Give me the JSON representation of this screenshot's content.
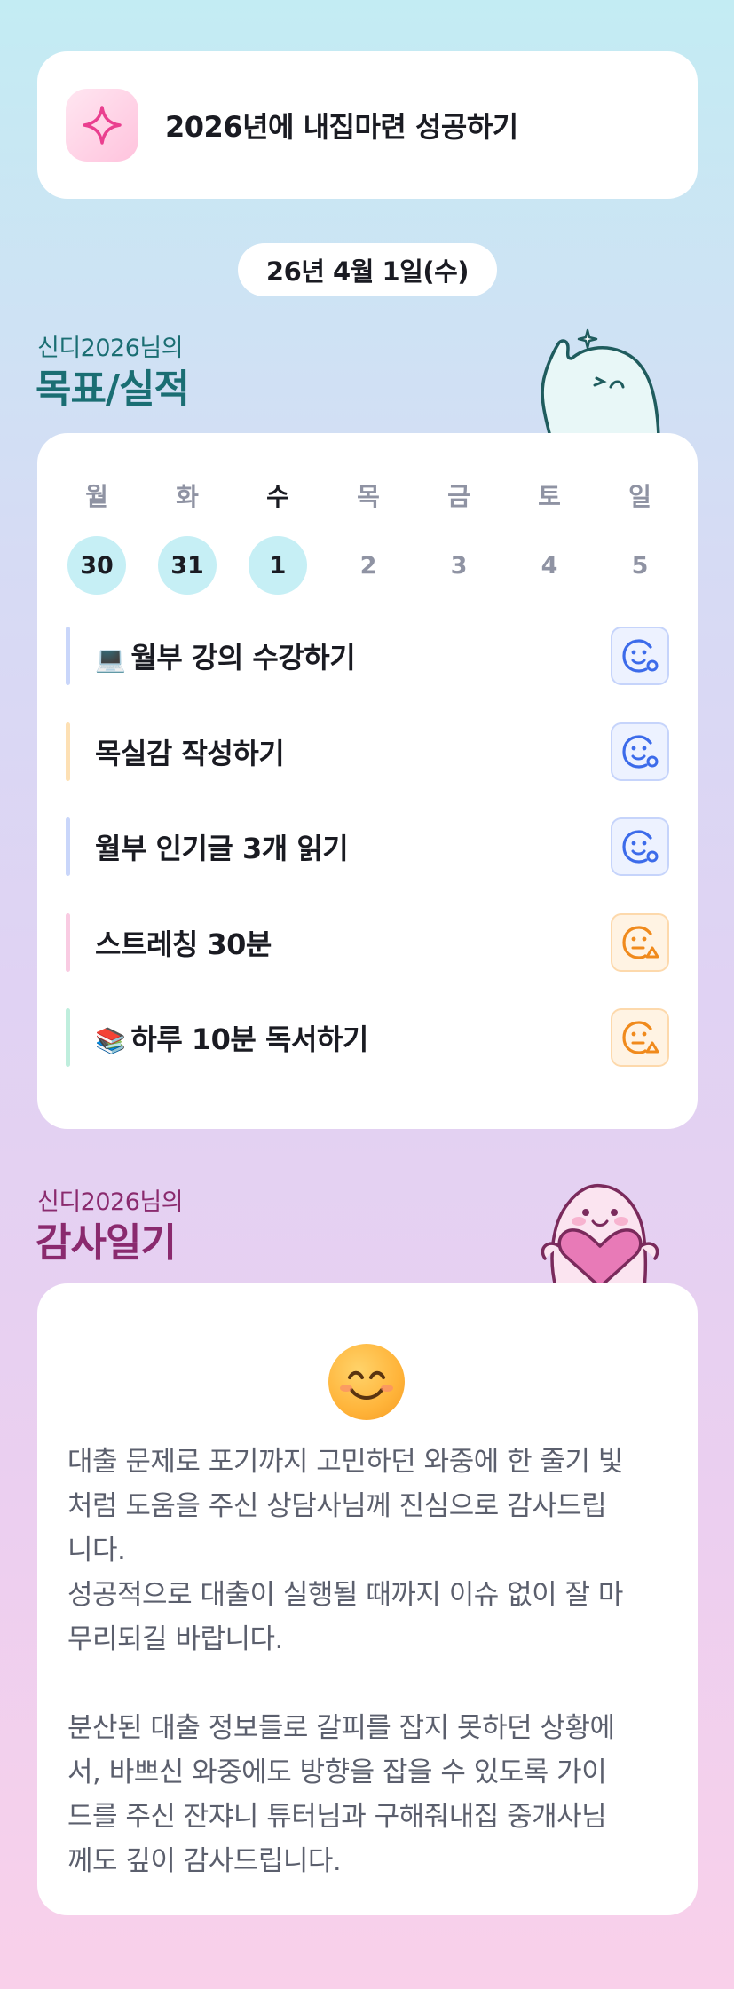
{
  "goal": {
    "icon": "sparkle-icon",
    "text": "2026년에 내집마련 성공하기"
  },
  "date": "26년 4월 1일(수)",
  "goals_section": {
    "subtitle": "신디2026님의",
    "title": "목표/실적",
    "title_color": "#1a6e73",
    "mascot": "mascot-waving-icon"
  },
  "week": [
    {
      "dow": "월",
      "day": "30",
      "done": true,
      "today": false
    },
    {
      "dow": "화",
      "day": "31",
      "done": true,
      "today": false
    },
    {
      "dow": "수",
      "day": "1",
      "done": true,
      "today": true
    },
    {
      "dow": "목",
      "day": "2",
      "done": false,
      "today": false
    },
    {
      "dow": "금",
      "day": "3",
      "done": false,
      "today": false
    },
    {
      "dow": "토",
      "day": "4",
      "done": false,
      "today": false
    },
    {
      "dow": "일",
      "day": "5",
      "done": false,
      "today": false
    }
  ],
  "tasks": [
    {
      "emoji": "💻",
      "label": "월부 강의 수강하기",
      "bar_color": "#c9d6fa",
      "status": "good"
    },
    {
      "emoji": "",
      "label": "목실감 작성하기",
      "bar_color": "#fde0b4",
      "status": "good"
    },
    {
      "emoji": "",
      "label": "월부 인기글 3개 읽기",
      "bar_color": "#c9d6fa",
      "status": "good"
    },
    {
      "emoji": "",
      "label": "스트레칭 30분",
      "bar_color": "#f9cbe2",
      "status": "meh"
    },
    {
      "emoji": "📚",
      "label": "하루 10분 독서하기",
      "bar_color": "#bfeedd",
      "status": "meh"
    }
  ],
  "diary_section": {
    "subtitle": "신디2026님의",
    "title": "감사일기",
    "title_color": "#8a2a6e",
    "mascot": "mascot-heart-icon"
  },
  "diary": {
    "emoji": "smiling-face-icon",
    "text": "대출 문제로 포기까지 고민하던 와중에 한 줄기 빛\n처럼 도움을 주신 상담사님께 진심으로 감사드립\n니다.\n성공적으로 대출이 실행될 때까지 이슈 없이 잘 마\n무리되길 바랍니다.\n\n분산된 대출 정보들로 갈피를 잡지 못하던 상황에\n서, 바쁘신 와중에도 방향을 잡을 수 있도록 가이\n드를 주신 잔쟈니 튜터님과 구해줘내집 중개사님\n께도 깊이 감사드립니다."
  },
  "colors": {
    "accent_blue": "#3c6bea",
    "accent_orange": "#f08a1c",
    "done_day": "#c6eff5"
  }
}
